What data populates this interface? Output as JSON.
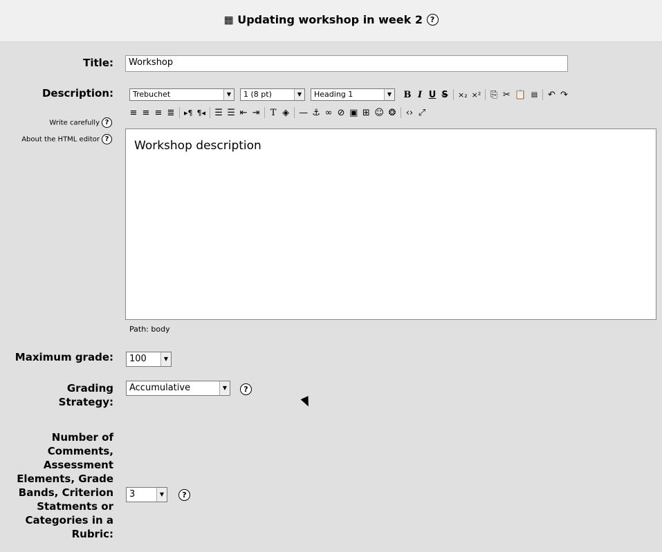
{
  "header": {
    "title": "Updating workshop in week 2",
    "help_glyph": "?"
  },
  "form": {
    "title_label": "Title:",
    "title_value": "Workshop",
    "description_label": "Description:",
    "help_links": [
      "Write carefully",
      "About the HTML editor"
    ],
    "editor": {
      "font": "Trebuchet",
      "size": "1 (8 pt)",
      "format": "Heading 1",
      "content": "Workshop description",
      "path_label": "Path:",
      "path_value": "body"
    },
    "max_grade_label": "Maximum grade:",
    "max_grade_value": "100",
    "grading_strategy_label_lines": [
      "Grading",
      "Strategy:"
    ],
    "grading_strategy_value": "Accumulative",
    "num_elements_label_lines": [
      "Number of",
      "Comments,",
      "Assessment",
      "Elements, Grade",
      "Bands, Criterion",
      "Statments or",
      "Categories in a",
      "Rubric:"
    ],
    "num_elements_value": "3"
  }
}
